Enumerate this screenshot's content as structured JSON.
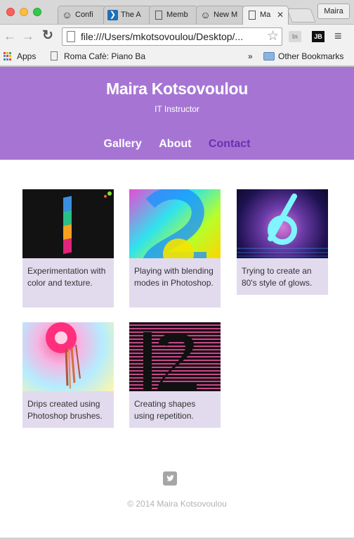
{
  "browser": {
    "tabs": [
      {
        "label": "Confi",
        "icon": "smiley-icon"
      },
      {
        "label": "The A",
        "icon": "vscode-icon"
      },
      {
        "label": "Memb",
        "icon": "page-icon"
      },
      {
        "label": "New M",
        "icon": "smiley-icon"
      },
      {
        "label": "Ma",
        "icon": "page-icon",
        "active": true
      }
    ],
    "profile_name": "Maira",
    "url": "file:///Users/mkotsovoulou/Desktop/...",
    "bookmarks": {
      "apps": "Apps",
      "roma": "Roma Cafè: Piano Ba",
      "more": "»",
      "other": "Other Bookmarks"
    },
    "extensions": {
      "in": "In",
      "jb": "JB"
    }
  },
  "site": {
    "title": "Maira Kotsovoulou",
    "subtitle": "IT Instructor",
    "nav": [
      {
        "label": "Gallery"
      },
      {
        "label": "About"
      },
      {
        "label": "Contact"
      }
    ],
    "accent": "#a675d4",
    "nav_current_color": "#6b2fb1"
  },
  "gallery": {
    "items": [
      {
        "caption": "Experimentation with color and texture.",
        "thumb_text": "1"
      },
      {
        "caption": "Playing with blending modes in Photoshop.",
        "thumb_text": "2"
      },
      {
        "caption": "Trying to create an 80's style of glows.",
        "thumb_text": "6"
      },
      {
        "caption": "Drips created using Photoshop brushes.",
        "thumb_text": "9"
      },
      {
        "caption": "Creating shapes using repetition.",
        "thumb_text": "12"
      }
    ]
  },
  "footer": {
    "social_icon": "twitter-icon",
    "copyright": "© 2014 Maira Kotsovoulou"
  }
}
